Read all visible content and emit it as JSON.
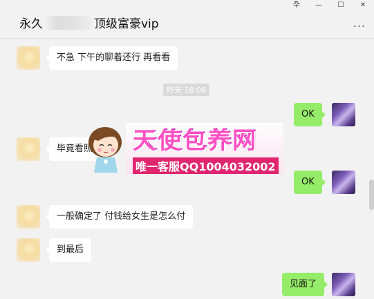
{
  "window": {
    "title_prefix": "永久",
    "title_suffix": "顶级富豪vip",
    "controls": {
      "pin": "卆",
      "minimize": "—",
      "maximize": "☐",
      "close": "✕"
    },
    "more": "..."
  },
  "messages": [
    {
      "side": "in",
      "text": "不急 下午的聊着还行 再看看"
    },
    {
      "side": "out",
      "text": "OK"
    },
    {
      "side": "in",
      "text": "毕竟看照"
    },
    {
      "side": "out",
      "text": "OK"
    },
    {
      "side": "in",
      "text": "一般确定了 付钱给女生是怎么付"
    },
    {
      "side": "in",
      "text": "到最后"
    },
    {
      "side": "out",
      "text": "见面了"
    }
  ],
  "timestamp": "昨天 18:06",
  "watermark": {
    "title": "天使包养网",
    "subtitle": "唯一客服QQ1004032002"
  },
  "colors": {
    "background": "#f2f2f2",
    "incoming_bubble": "#ffffff",
    "outgoing_bubble": "#95ec69",
    "watermark_pink": "#ff4fc4",
    "watermark_banner": "#e0266e"
  },
  "icons": {
    "pin": "pin-icon",
    "minimize": "minimize-icon",
    "maximize": "maximize-icon",
    "close": "close-icon",
    "more": "more-options-icon"
  }
}
